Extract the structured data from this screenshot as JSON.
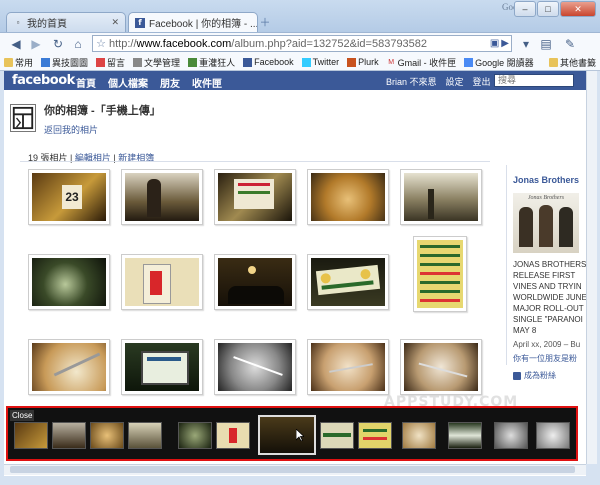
{
  "browser": {
    "tabs": [
      {
        "title": "我的首頁",
        "active": false
      },
      {
        "title": "Facebook | 你的相簿 - ...",
        "active": true
      }
    ],
    "google_label": "Google",
    "url_prefix": "http://",
    "url_host": "www.facebook.com",
    "url_path": "/album.php?aid=132752&id=583793582",
    "bookmarks": [
      "常用",
      "異技圖圖",
      "留言",
      "文學管理",
      "重灌狂人",
      "Facebook",
      "Twitter",
      "Plurk",
      "Gmail - 收件匣",
      "Google 閱讀器"
    ],
    "other_bookmarks": "其他書籤"
  },
  "facebook": {
    "logo": "facebook",
    "nav": [
      "首頁",
      "個人檔案",
      "朋友",
      "收件匣"
    ],
    "right_links": [
      "Brian 不來恩",
      "設定",
      "登出"
    ],
    "search_placeholder": "搜尋"
  },
  "album": {
    "title": "你的相簿 -「手機上傳」",
    "back_link": "返回我的相片",
    "photo_count": "19 張相片",
    "separator": " | ",
    "edit_link": "編輯相片",
    "new_link": "新建相簿"
  },
  "ad": {
    "title": "Jonas Brothers",
    "image_caption": "Jonas Brothers",
    "text_lines": [
      "JONAS BROTHERS",
      "RELEASE FIRST",
      "VINES AND TRYIN",
      "WORLDWIDE JUNE",
      "MAJOR ROLL-OUT",
      "SINGLE \"PARANOI",
      "MAY 8"
    ],
    "date": "April xx, 2009 – Bu",
    "friend_line": "你有一位朋友是粉",
    "fan_link": "成為粉絲"
  },
  "filmstrip": {
    "close_label": "Close",
    "thumb_count": 15
  },
  "watermark": "APPSTUDY.COM",
  "colors": {
    "facebook_blue": "#3b5998",
    "highlight_red": "#e01111"
  }
}
